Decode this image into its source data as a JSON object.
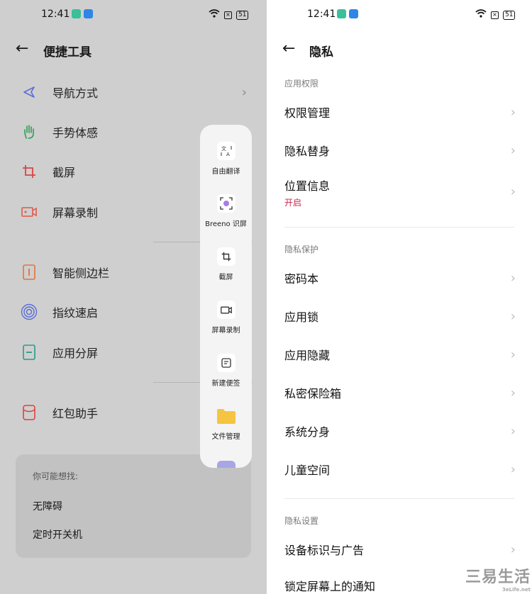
{
  "left": {
    "status": {
      "time": "12:41",
      "battery": "51"
    },
    "title": "便捷工具",
    "items": [
      {
        "label": "导航方式",
        "icon": "navigation-arrow-icon",
        "color": "#5a6dd6"
      },
      {
        "label": "手势体感",
        "icon": "hand-gesture-icon",
        "color": "#2e9e55"
      },
      {
        "label": "截屏",
        "icon": "crop-icon",
        "color": "#d84545"
      },
      {
        "label": "屏幕录制",
        "icon": "video-record-icon",
        "color": "#e05a4a"
      },
      {
        "label": "智能侧边栏",
        "icon": "sidebar-icon",
        "color": "#e4743a"
      },
      {
        "label": "指纹速启",
        "icon": "fingerprint-icon",
        "color": "#5a6dd6"
      },
      {
        "label": "应用分屏",
        "icon": "split-screen-icon",
        "color": "#2a9b8a"
      },
      {
        "label": "红包助手",
        "icon": "red-packet-icon",
        "color": "#d84545"
      }
    ],
    "suggest": {
      "heading": "你可能想找:",
      "items": [
        "无障碍",
        "定时开关机"
      ]
    }
  },
  "panel": {
    "items": [
      {
        "label": "自由翻译",
        "icon": "translate-icon"
      },
      {
        "label": "Breeno 识屏",
        "icon": "breeno-scan-icon"
      },
      {
        "label": "截屏",
        "icon": "crop-icon"
      },
      {
        "label": "屏幕录制",
        "icon": "video-record-icon"
      },
      {
        "label": "新建便签",
        "icon": "note-icon"
      },
      {
        "label": "文件管理",
        "icon": "folder-icon"
      }
    ]
  },
  "right": {
    "status": {
      "time": "12:41",
      "battery": "51"
    },
    "title": "隐私",
    "sections": {
      "s1": "应用权限",
      "s2": "隐私保护",
      "s3": "隐私设置"
    },
    "items": {
      "permission": "权限管理",
      "privacy_double": "隐私替身",
      "location": "位置信息",
      "location_status": "开启",
      "password_book": "密码本",
      "app_lock": "应用锁",
      "app_hide": "应用隐藏",
      "safe_box": "私密保险箱",
      "system_clone": "系统分身",
      "kids_space": "儿童空间",
      "device_id_ads": "设备标识与广告",
      "lock_screen_notif": "锁定屏幕上的通知"
    }
  },
  "watermark": {
    "text": "三易生活",
    "sub": "3eLife.net"
  }
}
